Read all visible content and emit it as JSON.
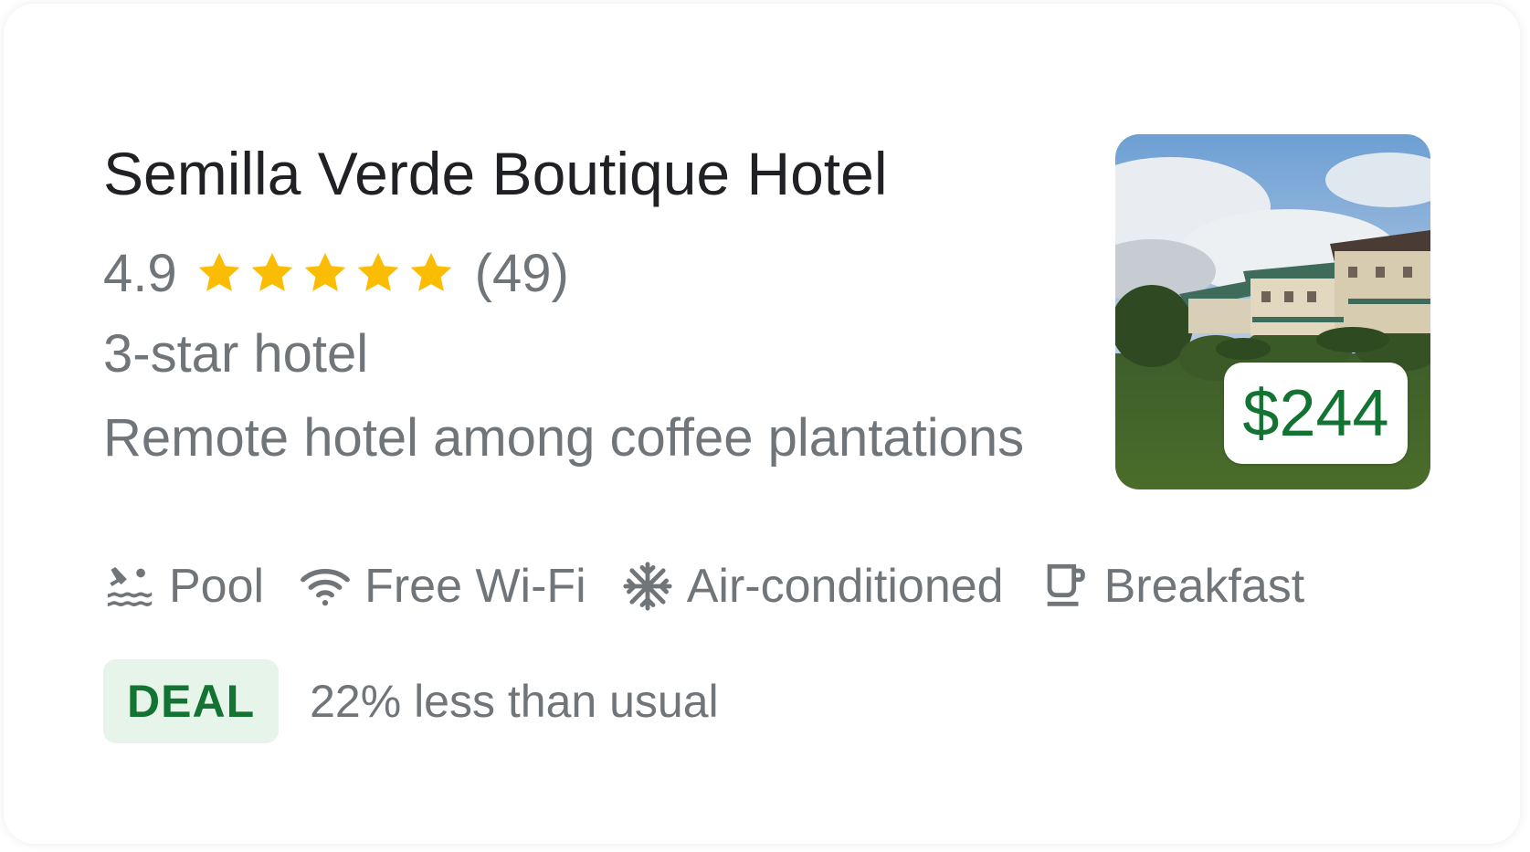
{
  "hotel": {
    "name": "Semilla Verde Boutique Hotel",
    "rating": "4.9",
    "rating_value": 4.9,
    "rating_max": 5,
    "review_count": "(49)",
    "hotel_class": "3-star hotel",
    "description": "Remote hotel among coffee plantations",
    "price": "$244"
  },
  "amenities": [
    {
      "icon": "pool-icon",
      "label": "Pool"
    },
    {
      "icon": "wifi-icon",
      "label": "Free Wi-Fi"
    },
    {
      "icon": "snowflake-icon",
      "label": "Air-conditioned"
    },
    {
      "icon": "coffee-cup-icon",
      "label": "Breakfast"
    }
  ],
  "deal": {
    "badge": "DEAL",
    "text": "22% less than usual"
  },
  "colors": {
    "title": "#202124",
    "secondary_text": "#70757a",
    "star": "#fbbc04",
    "price_green": "#137333",
    "deal_badge_bg": "#e6f4ea"
  }
}
